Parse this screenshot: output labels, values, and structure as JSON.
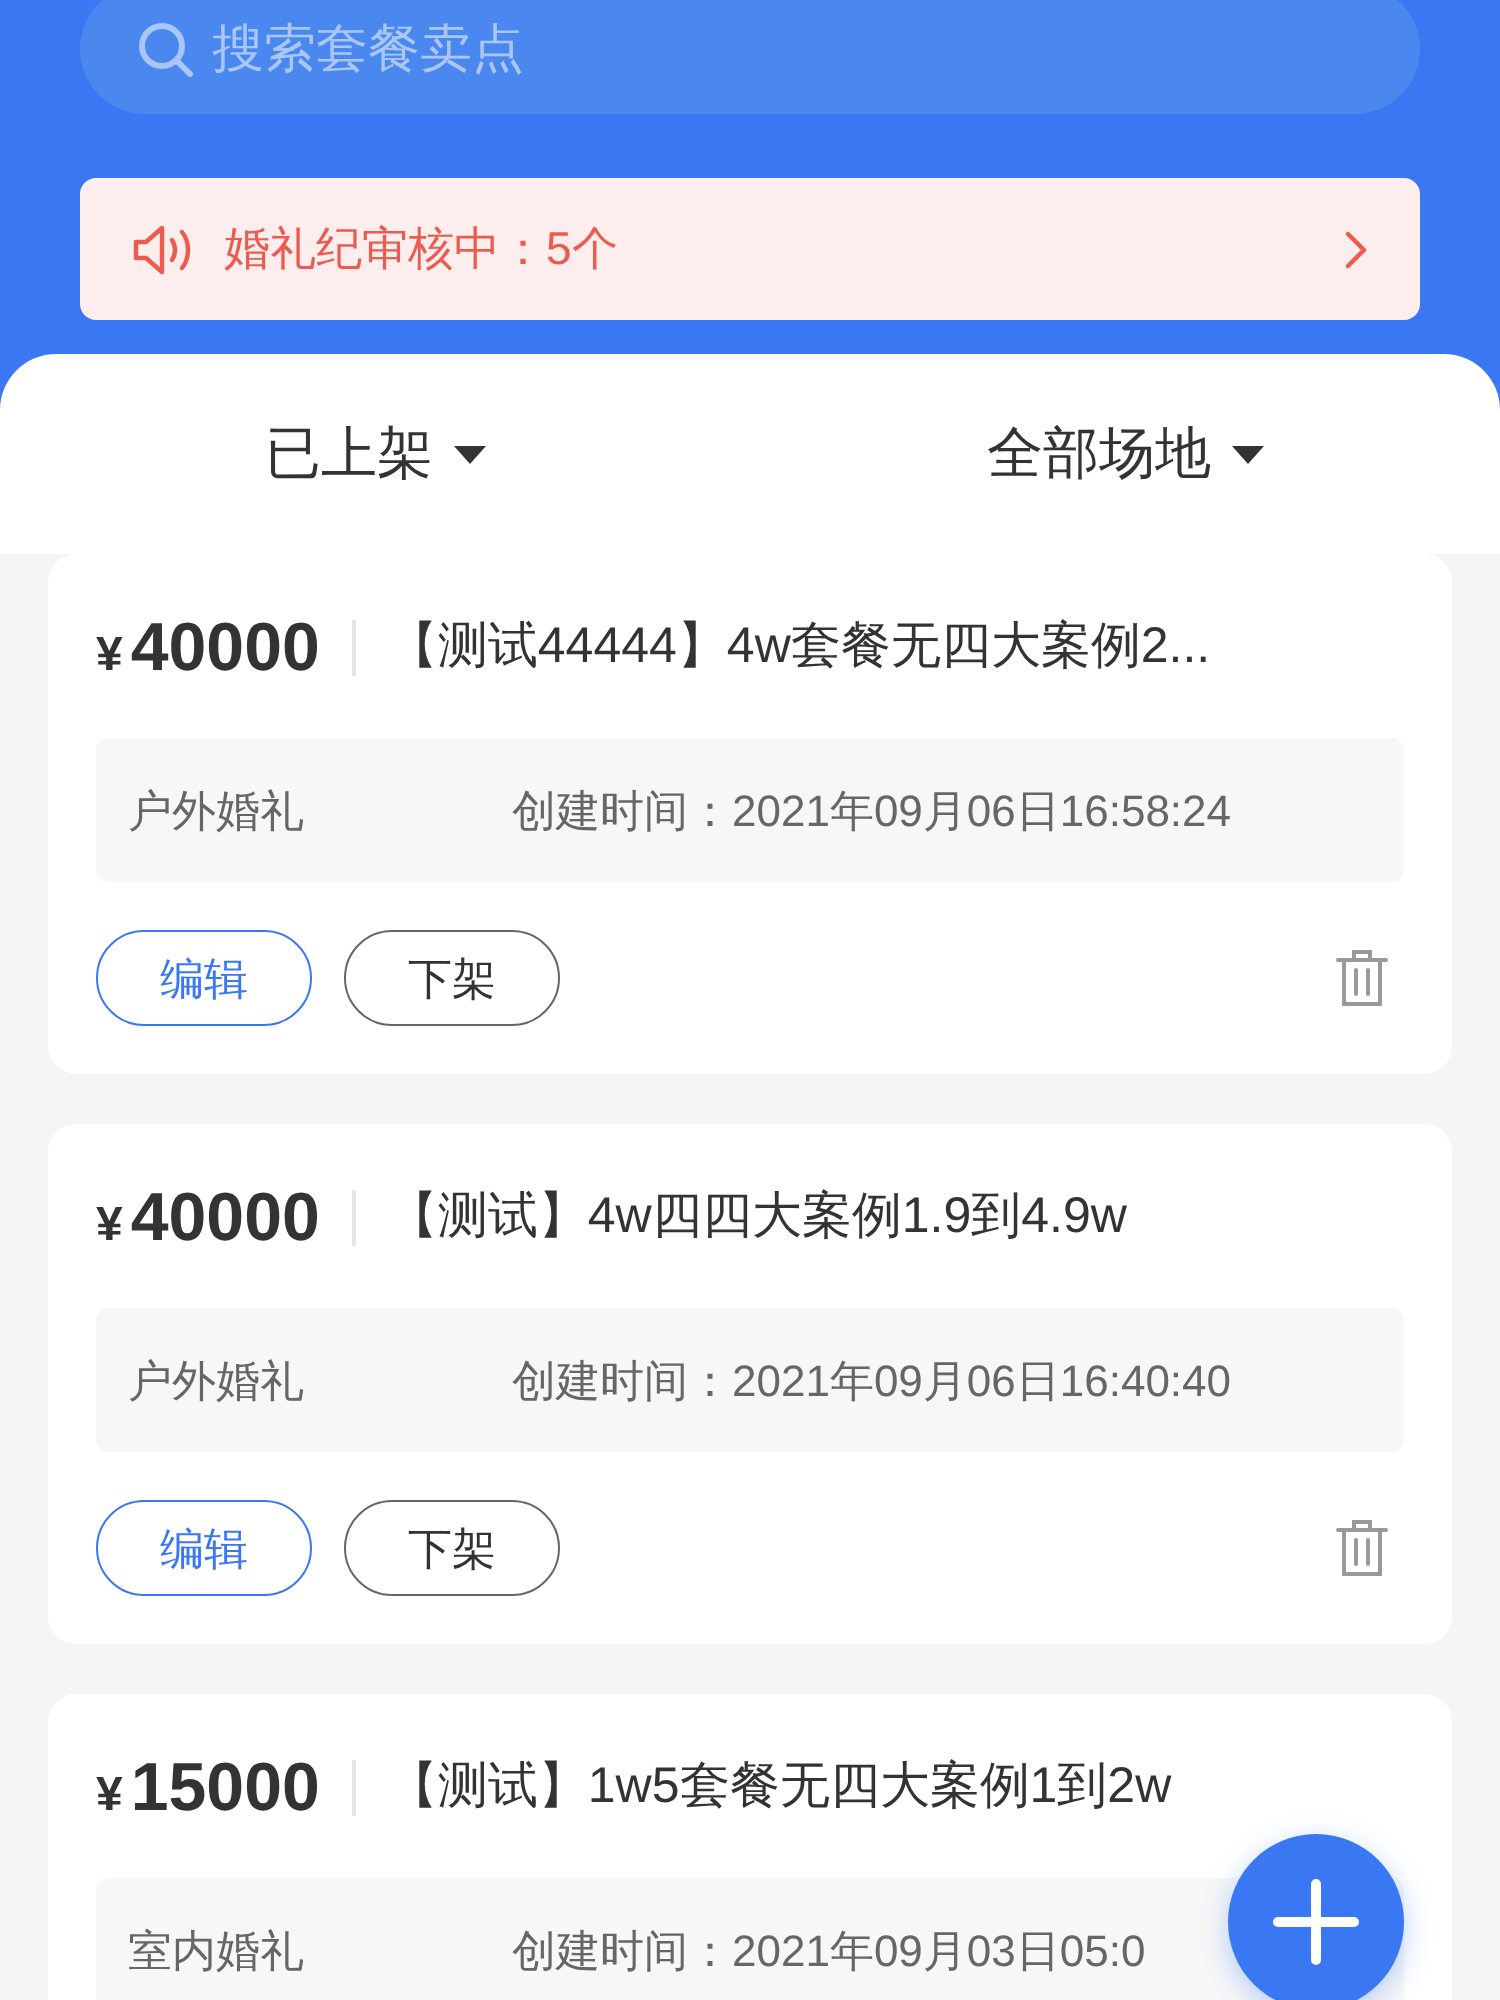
{
  "search": {
    "placeholder": "搜索套餐卖点"
  },
  "notice": {
    "text": "婚礼纪审核中：5个"
  },
  "filters": [
    {
      "label": "已上架"
    },
    {
      "label": "全部场地"
    }
  ],
  "packages": [
    {
      "currency": "¥",
      "price": "40000",
      "title": "【测试44444】4w套餐无四大案例2...",
      "venue": "户外婚礼",
      "created": "创建时间：2021年09月06日16:58:24",
      "buttons": [
        {
          "label": "编辑",
          "kind": "primary"
        },
        {
          "label": "下架",
          "kind": "plain"
        }
      ]
    },
    {
      "currency": "¥",
      "price": "40000",
      "title": "【测试】4w四四大案例1.9到4.9w",
      "venue": "户外婚礼",
      "created": "创建时间：2021年09月06日16:40:40",
      "buttons": [
        {
          "label": "编辑",
          "kind": "primary"
        },
        {
          "label": "下架",
          "kind": "plain"
        }
      ]
    },
    {
      "currency": "¥",
      "price": "15000",
      "title": "【测试】1w5套餐无四大案例1到2w",
      "venue": "室内婚礼",
      "created": "创建时间：2021年09月03日05:0"
    }
  ]
}
